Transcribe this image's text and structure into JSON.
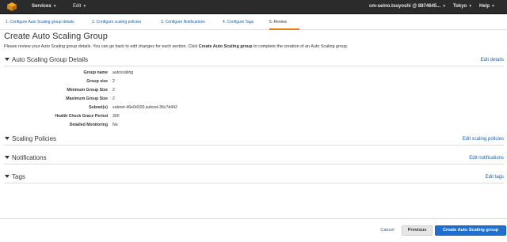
{
  "topnav": {
    "services_label": "Services",
    "edit_label": "Edit",
    "account_label": "cm-seino.tsuyoshi @ 8874645...",
    "region_label": "Tokyo",
    "help_label": "Help",
    "logo_icon": "aws-cube-icon"
  },
  "wizard": {
    "steps": [
      {
        "label": "1. Configure Auto Scaling group details"
      },
      {
        "label": "2. Configure scaling policies"
      },
      {
        "label": "3. Configure Notifications"
      },
      {
        "label": "4. Configure Tags"
      },
      {
        "label": "5. Review"
      }
    ],
    "active_index": 4,
    "accent_color": "#e47911"
  },
  "page": {
    "title": "Create Auto Scaling Group",
    "intro_before": "Please review your Auto Scaling group details. You can go back to edit changes for each section. Click ",
    "intro_bold": "Create Auto Scaling group",
    "intro_after": " to complete the creation of an Auto Scaling group."
  },
  "sections": {
    "details": {
      "title": "Auto Scaling Group Details",
      "edit_label": "Edit details",
      "rows": [
        {
          "label": "Group name",
          "value": "autoscaling"
        },
        {
          "label": "Group size",
          "value": "2"
        },
        {
          "label": "Minimum Group Size",
          "value": "2"
        },
        {
          "label": "Maximum Group Size",
          "value": "2"
        },
        {
          "label": "Subnet(s)",
          "value": "subnet-46e0d100,subnet-36c7d442"
        },
        {
          "label": "Health Check Grace Period",
          "value": "300"
        },
        {
          "label": "Detailed Monitoring",
          "value": "No"
        }
      ]
    },
    "policies": {
      "title": "Scaling Policies",
      "edit_label": "Edit scaling policies"
    },
    "notifications": {
      "title": "Notifications",
      "edit_label": "Edit notifications"
    },
    "tags": {
      "title": "Tags",
      "edit_label": "Edit tags"
    }
  },
  "footer": {
    "cancel_label": "Cancel",
    "previous_label": "Previous",
    "create_label": "Create Auto Scaling group",
    "primary_color": "#1f6fd0"
  }
}
